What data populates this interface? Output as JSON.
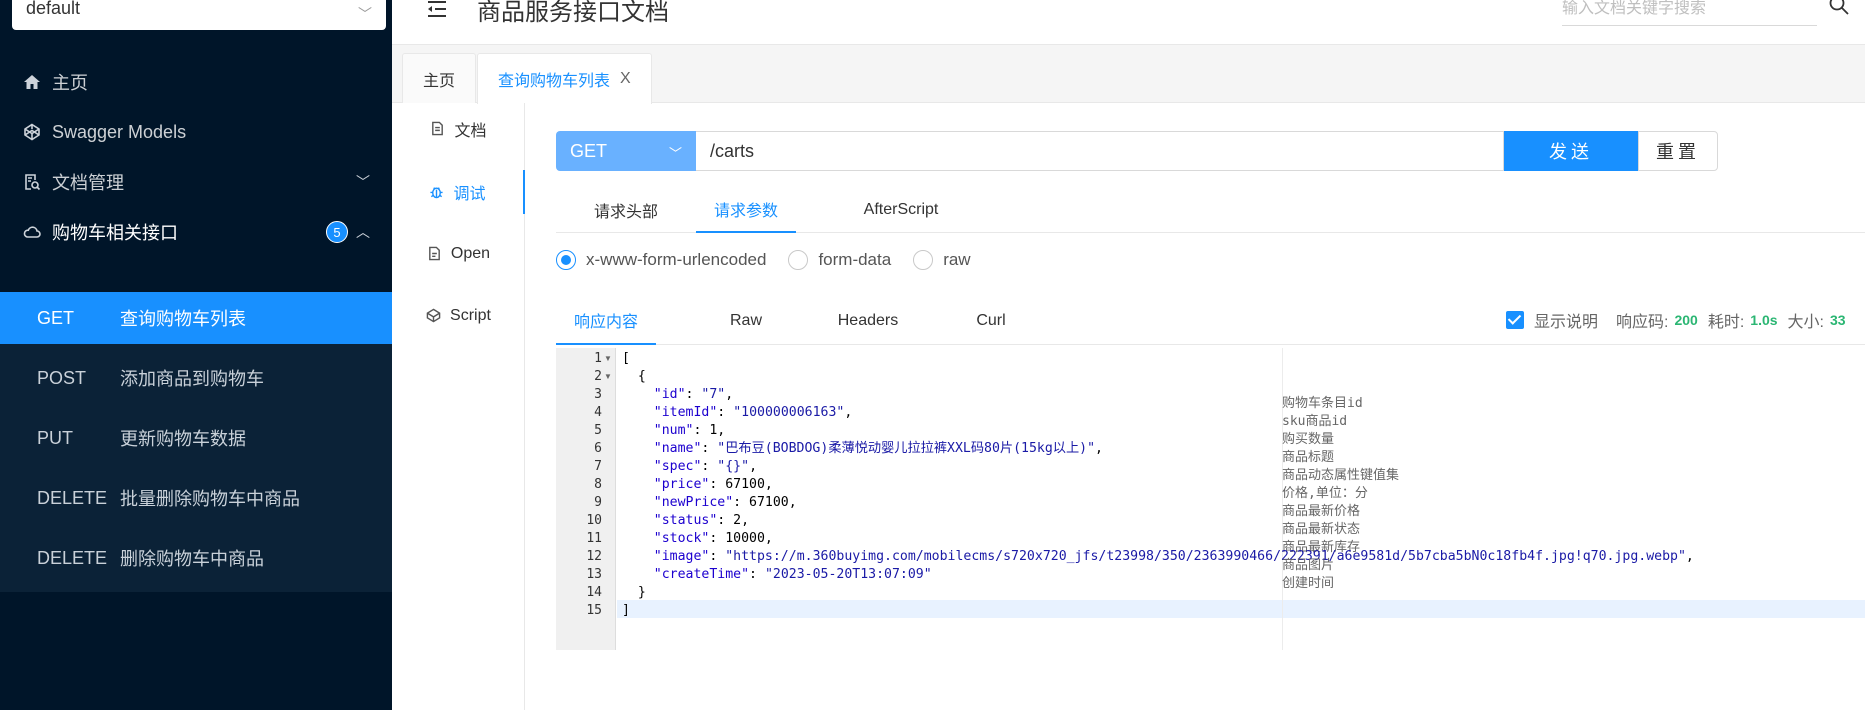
{
  "sidebar": {
    "group_select": "default",
    "items": [
      {
        "label": "主页"
      },
      {
        "label": "Swagger Models"
      },
      {
        "label": "文档管理"
      },
      {
        "label": "购物车相关接口",
        "badge": "5"
      }
    ],
    "apis": [
      {
        "method": "GET",
        "label": "查询购物车列表"
      },
      {
        "method": "POST",
        "label": "添加商品到购物车"
      },
      {
        "method": "PUT",
        "label": "更新购物车数据"
      },
      {
        "method": "DELETE",
        "label": "批量删除购物车中商品"
      },
      {
        "method": "DELETE",
        "label": "删除购物车中商品"
      }
    ]
  },
  "header": {
    "title": "商品服务接口文档",
    "search_placeholder": "输入文档关键字搜索"
  },
  "tabs": [
    {
      "label": "主页"
    },
    {
      "label": "查询购物车列表",
      "close": "X"
    }
  ],
  "mini_nav": [
    "文档",
    "调试",
    "Open",
    "Script"
  ],
  "request": {
    "method": "GET",
    "url": "/carts",
    "send": "发送",
    "reset": "重置"
  },
  "request_tabs": [
    "请求头部",
    "请求参数",
    "AfterScript"
  ],
  "body_types": [
    "x-www-form-urlencoded",
    "form-data",
    "raw"
  ],
  "response_tabs": [
    "响应内容",
    "Raw",
    "Headers",
    "Curl"
  ],
  "response_meta": {
    "show_desc": "显示说明",
    "code_label": "响应码:",
    "code": "200",
    "time_label": "耗时:",
    "time": "1.0s",
    "size_label": "大小:",
    "size": "33"
  },
  "code_lines": [
    {
      "n": "1",
      "t": "[",
      "d": ""
    },
    {
      "n": "2",
      "t": "  {",
      "d": ""
    },
    {
      "n": "3",
      "t": "    \"id\": \"7\",",
      "d": "购物车条目id"
    },
    {
      "n": "4",
      "t": "    \"itemId\": \"100000006163\",",
      "d": "sku商品id"
    },
    {
      "n": "5",
      "t": "    \"num\": 1,",
      "d": "购买数量"
    },
    {
      "n": "6",
      "t": "    \"name\": \"巴布豆(BOBDOG)柔薄悦动婴儿拉拉裤XXL码80片(15kg以上)\",",
      "d": "商品标题"
    },
    {
      "n": "7",
      "t": "    \"spec\": \"{}\",",
      "d": "商品动态属性键值集"
    },
    {
      "n": "8",
      "t": "    \"price\": 67100,",
      "d": "价格,单位：分"
    },
    {
      "n": "9",
      "t": "    \"newPrice\": 67100,",
      "d": "商品最新价格"
    },
    {
      "n": "10",
      "t": "    \"status\": 2,",
      "d": "商品最新状态"
    },
    {
      "n": "11",
      "t": "    \"stock\": 10000,",
      "d": "商品最新库存"
    },
    {
      "n": "12",
      "t": "    \"image\": \"https://m.360buyimg.com/mobilecms/s720x720_jfs/t23998/350/2363990466/222391/a6e9581d/5b7cba5bN0c18fb4f.jpg!q70.jpg.webp\",",
      "d": "商品图片"
    },
    {
      "n": "13",
      "t": "    \"createTime\": \"2023-05-20T13:07:09\"",
      "d": "创建时间"
    },
    {
      "n": "14",
      "t": "  }",
      "d": ""
    },
    {
      "n": "15",
      "t": "]",
      "d": ""
    }
  ]
}
